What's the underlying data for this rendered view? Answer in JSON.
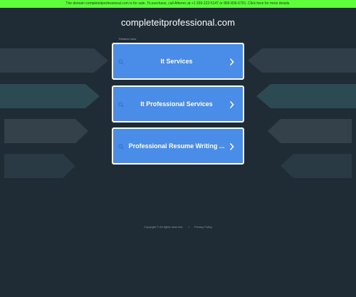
{
  "banner": {
    "text": "The domain completeitprofessional.com is for sale. To purchase, call Afternic at +1 339-222-5147 or 866-836-6791. Click here for more details."
  },
  "header": {
    "domain": "completeitprofessional.com"
  },
  "related": {
    "label": "Related Links",
    "links": [
      {
        "label": "It Services"
      },
      {
        "label": "It Professional Services"
      },
      {
        "label": "Professional Resume Writing ..."
      }
    ]
  },
  "footer": {
    "copyright": "Copyright © All rights reserved.",
    "separator": "•",
    "privacy": "Privacy Policy"
  },
  "colors": {
    "background": "#1f2c35",
    "banner": "#5cff3a",
    "button": "#4a8de8"
  },
  "icons": {
    "search": "search-icon",
    "chevron": "chevron-right-icon"
  }
}
